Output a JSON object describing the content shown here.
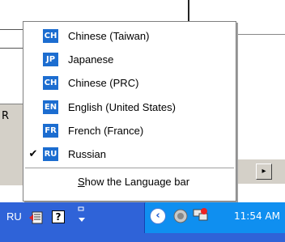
{
  "background": {
    "partial_letter": "R",
    "scroll_arrow": "▸"
  },
  "language_menu": {
    "items": [
      {
        "code": "CH",
        "label": "Chinese (Taiwan)",
        "checked": false
      },
      {
        "code": "JP",
        "label": "Japanese",
        "checked": false
      },
      {
        "code": "CH",
        "label": "Chinese (PRC)",
        "checked": false
      },
      {
        "code": "EN",
        "label": "English (United States)",
        "checked": false
      },
      {
        "code": "FR",
        "label": "French (France)",
        "checked": false
      },
      {
        "code": "RU",
        "label": "Russian",
        "checked": true
      }
    ],
    "check_mark": "✔",
    "show_bar_underlined": "S",
    "show_bar_rest": "how the Language bar"
  },
  "taskbar": {
    "language": "RU",
    "help_icon_text": "?",
    "options_glyph": "⁼",
    "tray_arrow": "‹",
    "clock": "11:54 AM"
  },
  "colors": {
    "badge_blue": "#1c6dd0",
    "taskbar_blue": "#2f63d8",
    "tray_blue": "#0f8ff0"
  },
  "icons": {
    "lang_icon": "language-options-icon",
    "help": "help-icon",
    "options": "options-icon",
    "tray_expand": "chevron-left-icon",
    "speaker": "speaker-icon",
    "network": "network-icon"
  }
}
